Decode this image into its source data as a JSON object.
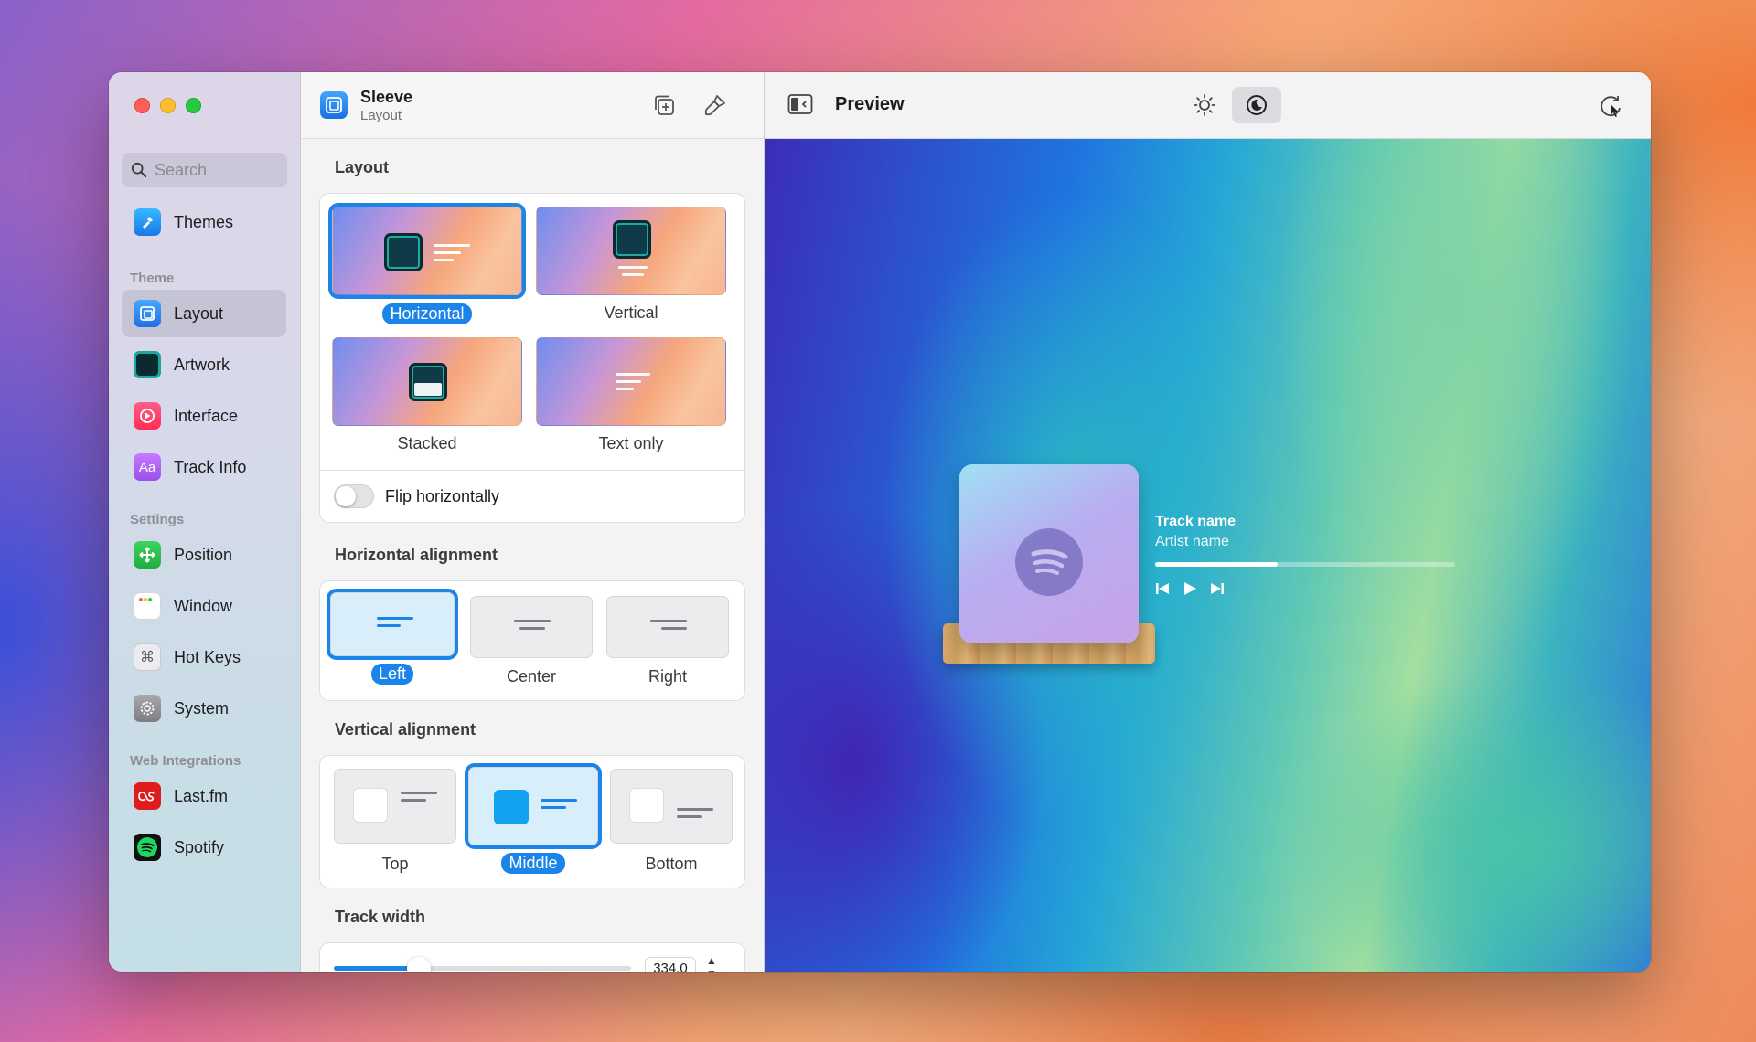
{
  "sidebar": {
    "search_placeholder": "Search",
    "themes_label": "Themes",
    "theme_header": "Theme",
    "theme_items": [
      {
        "label": "Layout",
        "icon": "layout-icon",
        "color": "#2f8cf0"
      },
      {
        "label": "Artwork",
        "icon": "artwork-icon",
        "color": "#0f6b6b"
      },
      {
        "label": "Interface",
        "icon": "interface-icon",
        "color": "#ff3b6b"
      },
      {
        "label": "Track Info",
        "icon": "track-info-icon",
        "color": "#b15cf0"
      }
    ],
    "settings_header": "Settings",
    "settings_items": [
      {
        "label": "Position",
        "icon": "position-icon",
        "color": "#25c04a"
      },
      {
        "label": "Window",
        "icon": "window-icon",
        "color": "#ffffff"
      },
      {
        "label": "Hot Keys",
        "icon": "hotkeys-icon",
        "color": "#e0e0e4"
      },
      {
        "label": "System",
        "icon": "system-icon",
        "color": "#8e8e93"
      }
    ],
    "web_header": "Web Integrations",
    "web_items": [
      {
        "label": "Last.fm",
        "icon": "lastfm-icon",
        "color": "#e01b1b"
      },
      {
        "label": "Spotify",
        "icon": "spotify-icon",
        "color": "#111111"
      }
    ]
  },
  "settings_panel": {
    "app_title": "Sleeve",
    "app_subtitle": "Layout",
    "layout_title": "Layout",
    "layout_options": [
      "Horizontal",
      "Vertical",
      "Stacked",
      "Text only"
    ],
    "layout_selected": "Horizontal",
    "flip_label": "Flip horizontally",
    "flip_on": false,
    "halign_title": "Horizontal alignment",
    "halign_options": [
      "Left",
      "Center",
      "Right"
    ],
    "halign_selected": "Left",
    "valign_title": "Vertical alignment",
    "valign_options": [
      "Top",
      "Middle",
      "Bottom"
    ],
    "valign_selected": "Middle",
    "track_width_title": "Track width",
    "track_width_value": "334.0"
  },
  "preview": {
    "title": "Preview",
    "track_name": "Track name",
    "artist_name": "Artist name",
    "progress": 0.41
  },
  "colors": {
    "accent": "#1a84e8"
  }
}
